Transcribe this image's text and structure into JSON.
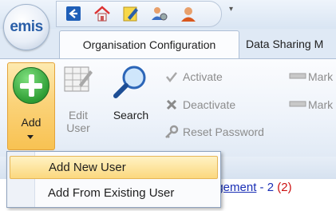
{
  "app": {
    "logo_text": "emis"
  },
  "quick_access": {
    "icons": [
      "back-arrow-icon",
      "home-icon",
      "edit-note-icon",
      "users-settings-icon",
      "user-profile-icon"
    ],
    "dropdown_glyph": "▾"
  },
  "tabs": [
    {
      "label": "Organisation Configuration",
      "active": true
    },
    {
      "label": "Data Sharing M",
      "active": false
    }
  ],
  "ribbon": {
    "add_label": "Add",
    "edit_user_label_line1": "Edit",
    "edit_user_label_line2": "User",
    "search_label": "Search",
    "activate_label": "Activate",
    "deactivate_label": "Deactivate",
    "reset_password_label": "Reset Password",
    "mark_label_1": "Mark",
    "mark_label_2": "Mark"
  },
  "add_menu": {
    "items": [
      {
        "label": "Add New User",
        "highlighted": true
      },
      {
        "label": "Add From Existing User",
        "highlighted": false
      }
    ]
  },
  "content": {
    "management_link": "agement",
    "separator": " - ",
    "count": "2",
    "count_red": "(2)"
  },
  "colors": {
    "accent_orange": "#f8c252",
    "link_blue": "#1a2fb5",
    "alert_red": "#cc1111",
    "ribbon_bg": "#eef3fa"
  }
}
